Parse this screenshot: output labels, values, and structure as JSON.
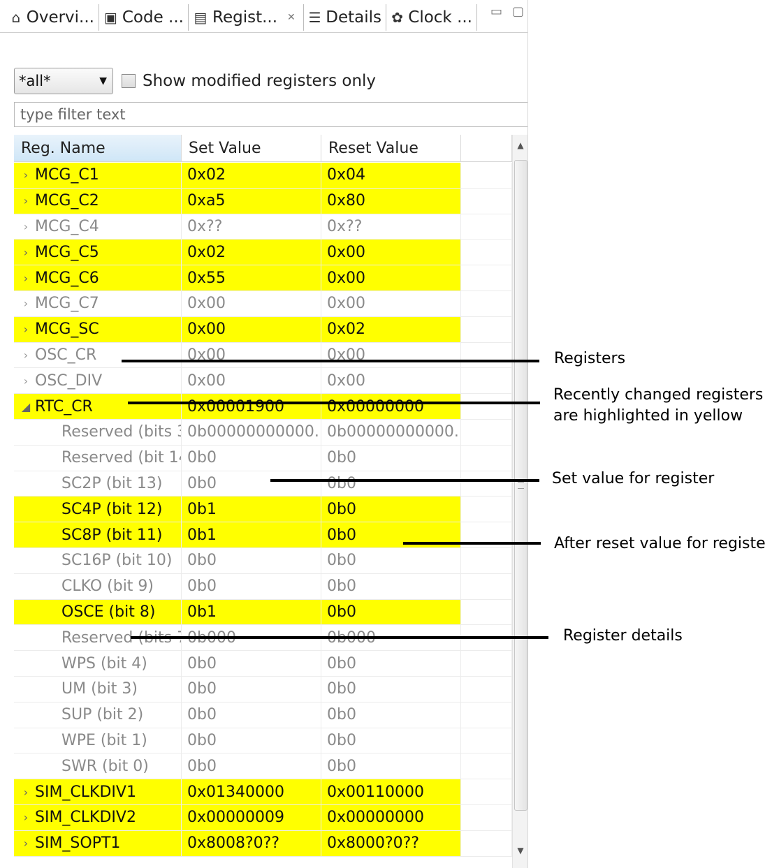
{
  "tabs": [
    {
      "icon": "home-icon",
      "glyph": "⌂",
      "label": "Overvi..."
    },
    {
      "icon": "code-icon",
      "glyph": "▣",
      "label": "Code ..."
    },
    {
      "icon": "registers-icon",
      "glyph": "▤",
      "label": "Regist...",
      "close": "✕"
    },
    {
      "icon": "list-icon",
      "glyph": "☰",
      "label": "Details"
    },
    {
      "icon": "clock-icon",
      "glyph": "✿",
      "label": "Clock ..."
    }
  ],
  "toolbar": {
    "filter_select": "*all*",
    "show_modified_label": "Show modified registers only",
    "filter_placeholder": "type filter text"
  },
  "table": {
    "columns": [
      "Reg. Name",
      "Set Value",
      "Reset Value"
    ],
    "rows": [
      {
        "name": "MCG_C1",
        "set": "0x02",
        "reset": "0x04",
        "modified": true,
        "level": 0,
        "toggle": "›"
      },
      {
        "name": "MCG_C2",
        "set": "0xa5",
        "reset": "0x80",
        "modified": true,
        "level": 0,
        "toggle": "›"
      },
      {
        "name": "MCG_C4",
        "set": "0x??",
        "reset": "0x??",
        "modified": false,
        "level": 0,
        "toggle": "›"
      },
      {
        "name": "MCG_C5",
        "set": "0x02",
        "reset": "0x00",
        "modified": true,
        "level": 0,
        "toggle": "›"
      },
      {
        "name": "MCG_C6",
        "set": "0x55",
        "reset": "0x00",
        "modified": true,
        "level": 0,
        "toggle": "›"
      },
      {
        "name": "MCG_C7",
        "set": "0x00",
        "reset": "0x00",
        "modified": false,
        "level": 0,
        "toggle": "›"
      },
      {
        "name": "MCG_SC",
        "set": "0x00",
        "reset": "0x02",
        "modified": true,
        "level": 0,
        "toggle": "›"
      },
      {
        "name": "OSC_CR",
        "set": "0x00",
        "reset": "0x00",
        "modified": false,
        "level": 0,
        "toggle": "›"
      },
      {
        "name": "OSC_DIV",
        "set": "0x00",
        "reset": "0x00",
        "modified": false,
        "level": 0,
        "toggle": "›"
      },
      {
        "name": "RTC_CR",
        "set": "0x00001900",
        "reset": "0x00000000",
        "modified": true,
        "level": 0,
        "toggle": "◢"
      },
      {
        "name": "Reserved (bits 3",
        "set": "0b00000000000...",
        "reset": "0b00000000000...",
        "modified": false,
        "level": 1,
        "toggle": ""
      },
      {
        "name": "Reserved (bit 14",
        "set": "0b0",
        "reset": "0b0",
        "modified": false,
        "level": 1,
        "toggle": ""
      },
      {
        "name": "SC2P (bit 13)",
        "set": "0b0",
        "reset": "0b0",
        "modified": false,
        "level": 1,
        "toggle": ""
      },
      {
        "name": "SC4P (bit 12)",
        "set": "0b1",
        "reset": "0b0",
        "modified": true,
        "level": 1,
        "toggle": ""
      },
      {
        "name": "SC8P (bit 11)",
        "set": "0b1",
        "reset": "0b0",
        "modified": true,
        "level": 1,
        "toggle": ""
      },
      {
        "name": "SC16P (bit 10)",
        "set": "0b0",
        "reset": "0b0",
        "modified": false,
        "level": 1,
        "toggle": ""
      },
      {
        "name": "CLKO (bit 9)",
        "set": "0b0",
        "reset": "0b0",
        "modified": false,
        "level": 1,
        "toggle": ""
      },
      {
        "name": "OSCE (bit 8)",
        "set": "0b1",
        "reset": "0b0",
        "modified": true,
        "level": 1,
        "toggle": ""
      },
      {
        "name": "Reserved (bits 7",
        "set": "0b000",
        "reset": "0b000",
        "modified": false,
        "level": 1,
        "toggle": ""
      },
      {
        "name": "WPS (bit 4)",
        "set": "0b0",
        "reset": "0b0",
        "modified": false,
        "level": 1,
        "toggle": ""
      },
      {
        "name": "UM (bit 3)",
        "set": "0b0",
        "reset": "0b0",
        "modified": false,
        "level": 1,
        "toggle": ""
      },
      {
        "name": "SUP (bit 2)",
        "set": "0b0",
        "reset": "0b0",
        "modified": false,
        "level": 1,
        "toggle": ""
      },
      {
        "name": "WPE (bit 1)",
        "set": "0b0",
        "reset": "0b0",
        "modified": false,
        "level": 1,
        "toggle": ""
      },
      {
        "name": "SWR (bit 0)",
        "set": "0b0",
        "reset": "0b0",
        "modified": false,
        "level": 1,
        "toggle": ""
      },
      {
        "name": "SIM_CLKDIV1",
        "set": "0x01340000",
        "reset": "0x00110000",
        "modified": true,
        "level": 0,
        "toggle": "›"
      },
      {
        "name": "SIM_CLKDIV2",
        "set": "0x00000009",
        "reset": "0x00000000",
        "modified": true,
        "level": 0,
        "toggle": "›"
      },
      {
        "name": "SIM_SOPT1",
        "set": "0x8008?0??",
        "reset": "0x8000?0??",
        "modified": true,
        "level": 0,
        "toggle": "›"
      }
    ]
  },
  "annotations": {
    "registers": "Registers",
    "highlight_1": "Recently changed registers",
    "highlight_2": "are highlighted in yellow",
    "set_value": "Set value for register",
    "reset_value": "After reset value for registe",
    "details": "Register details"
  },
  "colors": {
    "modified_highlight": "#ffff00",
    "unmodified_text": "#8a8a8a"
  }
}
